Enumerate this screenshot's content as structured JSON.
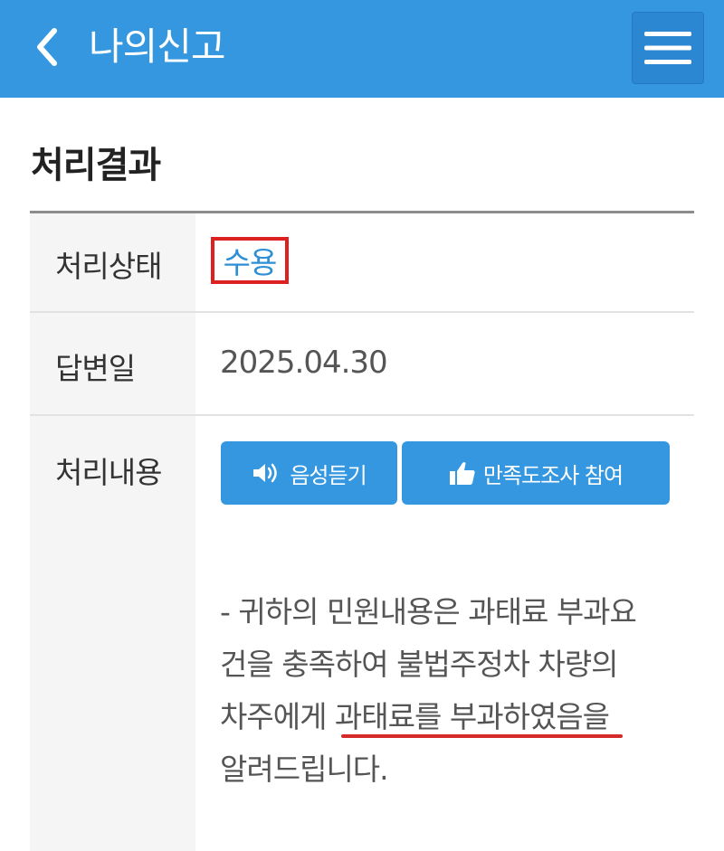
{
  "header": {
    "title": "나의신고",
    "back_icon": "chevron-left-icon",
    "menu_icon": "hamburger-menu-icon",
    "bg_color": "#3597e0"
  },
  "section": {
    "title": "처리결과"
  },
  "rows": {
    "status": {
      "label": "처리상태",
      "value": "수용",
      "highlight_color": "#dd2020"
    },
    "answer_date": {
      "label": "답변일",
      "value": "2025.04.30"
    },
    "content": {
      "label": "처리내용",
      "listen_button": "음성듣기",
      "survey_button": "만족도조사 참여",
      "lines": [
        "- 귀하의 민원내용은 과태료 부과요",
        "건을 충족하여 불법주정차 차량의",
        "차주에게 과태료를 부과하였음을",
        "알려드립니다."
      ]
    }
  }
}
